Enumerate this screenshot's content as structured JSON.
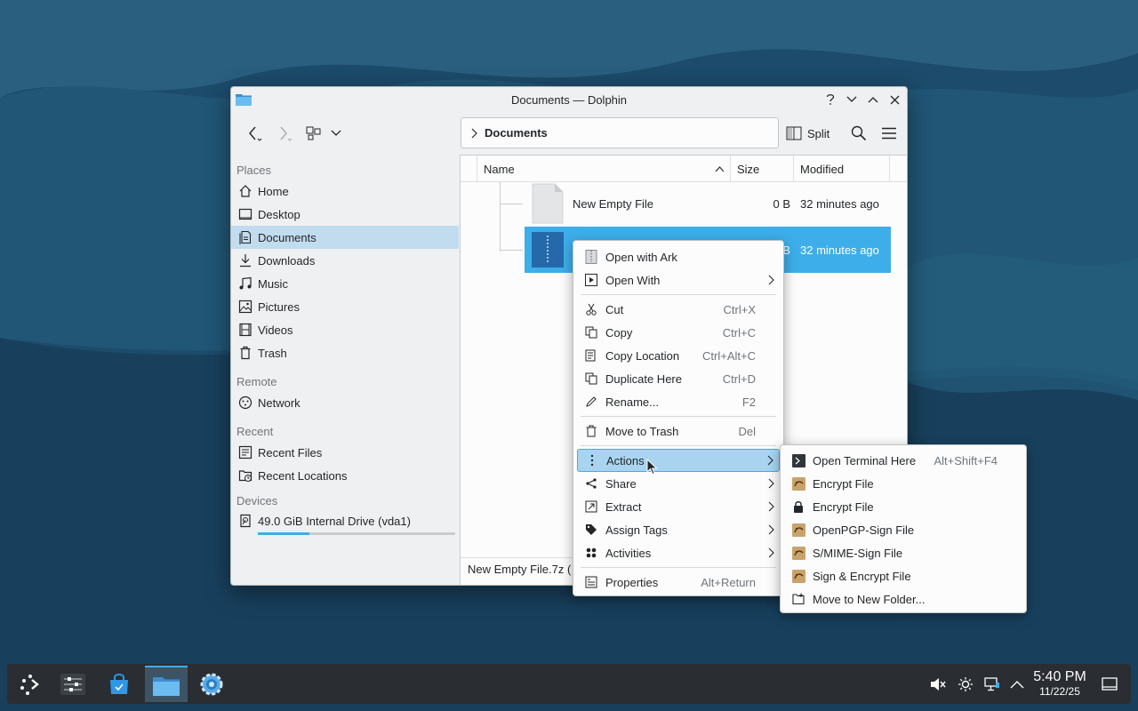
{
  "window": {
    "title": "Documents — Dolphin"
  },
  "toolbar": {
    "breadcrumb": "Documents",
    "split_label": "Split"
  },
  "sidebar": {
    "sections": {
      "places": "Places",
      "remote": "Remote",
      "recent": "Recent",
      "devices": "Devices"
    },
    "places": [
      "Home",
      "Desktop",
      "Documents",
      "Downloads",
      "Music",
      "Pictures",
      "Videos",
      "Trash"
    ],
    "remote": [
      "Network"
    ],
    "recent": [
      "Recent Files",
      "Recent Locations"
    ],
    "devices": [
      "49.0 GiB Internal Drive (vda1)"
    ],
    "drive_usage_fraction": 0.26
  },
  "files": {
    "columns": [
      "Name",
      "Size",
      "Modified"
    ],
    "rows": [
      {
        "name": "New Empty File",
        "size": "0 B",
        "modified": "32 minutes ago"
      },
      {
        "name": "",
        "size": "B",
        "modified": "32 minutes ago"
      }
    ],
    "status": "New Empty File.7z ("
  },
  "context_menu": {
    "items": [
      {
        "label": "Open with Ark",
        "icon": "ark-icon"
      },
      {
        "label": "Open With",
        "icon": "open-with-icon",
        "submenu": true
      },
      {
        "label": "Cut",
        "shortcut": "Ctrl+X",
        "icon": "cut-icon"
      },
      {
        "label": "Copy",
        "shortcut": "Ctrl+C",
        "icon": "copy-icon"
      },
      {
        "label": "Copy Location",
        "shortcut": "Ctrl+Alt+C",
        "icon": "copy-location-icon"
      },
      {
        "label": "Duplicate Here",
        "shortcut": "Ctrl+D",
        "icon": "duplicate-icon"
      },
      {
        "label": "Rename...",
        "shortcut": "F2",
        "icon": "rename-icon"
      },
      {
        "label": "Move to Trash",
        "shortcut": "Del",
        "icon": "trash-icon"
      },
      {
        "label": "Actions",
        "icon": "actions-icon",
        "submenu": true
      },
      {
        "label": "Share",
        "icon": "share-icon",
        "submenu": true
      },
      {
        "label": "Extract",
        "icon": "extract-icon",
        "submenu": true
      },
      {
        "label": "Assign Tags",
        "icon": "tag-icon",
        "submenu": true
      },
      {
        "label": "Activities",
        "icon": "activities-icon",
        "submenu": true
      },
      {
        "label": "Properties",
        "shortcut": "Alt+Return",
        "icon": "properties-icon"
      }
    ]
  },
  "actions_submenu": {
    "items": [
      {
        "label": "Open Terminal Here",
        "shortcut": "Alt+Shift+F4",
        "icon": "terminal-icon"
      },
      {
        "label": "Encrypt File",
        "icon": "kleopatra-icon"
      },
      {
        "label": "Encrypt File",
        "icon": "lock-icon"
      },
      {
        "label": "OpenPGP-Sign File",
        "icon": "kleopatra-icon"
      },
      {
        "label": "S/MIME-Sign File",
        "icon": "kleopatra-icon"
      },
      {
        "label": "Sign & Encrypt File",
        "icon": "kleopatra-icon"
      },
      {
        "label": "Move to New Folder...",
        "icon": "new-folder-icon"
      }
    ]
  },
  "taskbar": {
    "time": "5:40 PM",
    "date": "11/22/25"
  },
  "colors": {
    "accent": "#3daee9",
    "selection": "#3daee9",
    "hover": "#a9d4f0",
    "panel": "#2a2e32"
  }
}
